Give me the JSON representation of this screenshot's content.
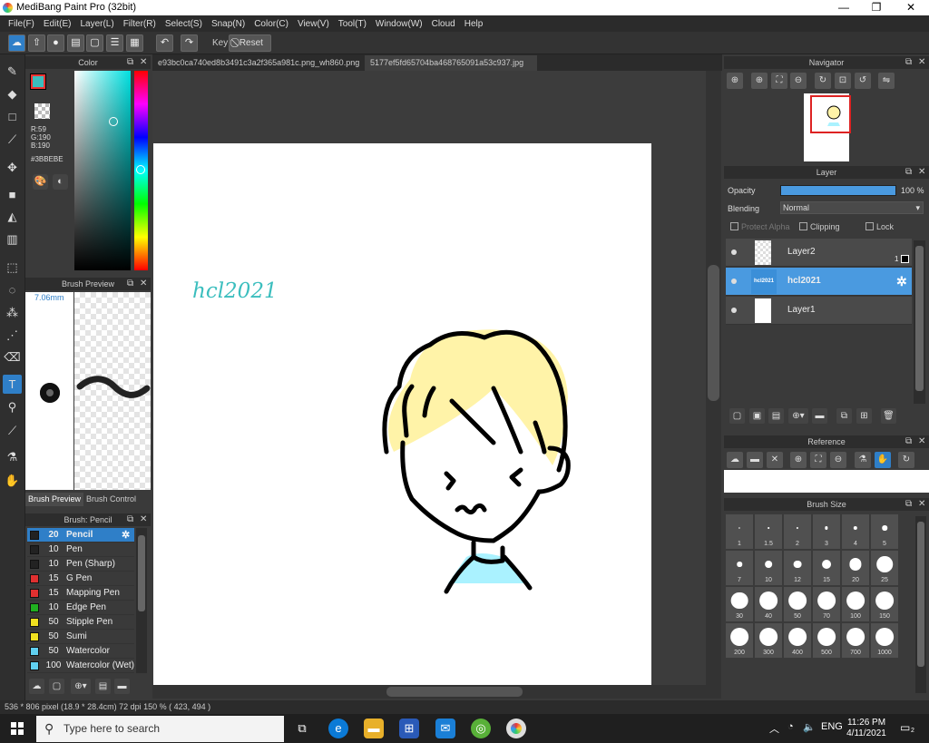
{
  "window": {
    "title": "MediBang Paint Pro (32bit)",
    "min": "—",
    "max": "❐",
    "close": "✕"
  },
  "menu": [
    "File(F)",
    "Edit(E)",
    "Layer(L)",
    "Filter(R)",
    "Select(S)",
    "Snap(N)",
    "Color(C)",
    "View(V)",
    "Tool(T)",
    "Window(W)",
    "Cloud",
    "Help"
  ],
  "toolbar": {
    "key_label": "Key",
    "reset_label": "Reset"
  },
  "color_panel": {
    "title": "Color",
    "hex": "#3BBEBE",
    "r": "R:59",
    "g": "G:190",
    "b": "B:190",
    "main_color": "#3bbebe",
    "sub_color": "#ffffff"
  },
  "brush_preview": {
    "title": "Brush Preview",
    "size": "7.06mm",
    "tab_preview": "Brush Preview",
    "tab_control": "Brush Control"
  },
  "brush_list": {
    "title": "Brush: Pencil",
    "items": [
      {
        "size": "20",
        "name": "Pencil",
        "color": "#222222",
        "selected": true
      },
      {
        "size": "10",
        "name": "Pen",
        "color": "#222222"
      },
      {
        "size": "10",
        "name": "Pen (Sharp)",
        "color": "#222222"
      },
      {
        "size": "15",
        "name": "G Pen",
        "color": "#e03030"
      },
      {
        "size": "15",
        "name": "Mapping Pen",
        "color": "#e03030"
      },
      {
        "size": "10",
        "name": "Edge Pen",
        "color": "#20b020"
      },
      {
        "size": "50",
        "name": "Stipple Pen",
        "color": "#f0e020"
      },
      {
        "size": "50",
        "name": "Sumi",
        "color": "#f0e020"
      },
      {
        "size": "50",
        "name": "Watercolor",
        "color": "#60d0f0"
      },
      {
        "size": "100",
        "name": "Watercolor (Wet)",
        "color": "#60d0f0"
      }
    ]
  },
  "doc_tabs": [
    {
      "label": "e93bc0ca740ed8b3491c3a2f365a981c.png_wh860.png",
      "active": false
    },
    {
      "label": "5177ef5fd65704ba468765091a53c937.jpg",
      "active": true
    }
  ],
  "canvas": {
    "signature": "hcl2021"
  },
  "status": {
    "text": "536 * 806 pixel   (18.9 * 28.4cm)   72 dpi   150 %   ( 423, 494 )"
  },
  "navigator": {
    "title": "Navigator"
  },
  "layer_panel": {
    "title": "Layer",
    "opacity_label": "Opacity",
    "opacity_value": "100 %",
    "blending_label": "Blending",
    "blending_value": "Normal",
    "protect_alpha": "Protect Alpha",
    "clipping": "Clipping",
    "lock": "Lock",
    "layers": [
      {
        "name": "Layer2",
        "badge": "1",
        "selected": false
      },
      {
        "name": "hcl2021",
        "selected": true
      },
      {
        "name": "Layer1",
        "selected": false
      }
    ]
  },
  "reference": {
    "title": "Reference"
  },
  "brush_size": {
    "title": "Brush Size",
    "sizes": [
      "1",
      "1.5",
      "2",
      "3",
      "4",
      "5",
      "7",
      "10",
      "12",
      "15",
      "20",
      "25",
      "30",
      "40",
      "50",
      "70",
      "100",
      "150",
      "200",
      "300",
      "400",
      "500",
      "700",
      "1000"
    ]
  },
  "taskbar": {
    "search_placeholder": "Type here to search",
    "lang": "ENG",
    "time": "11:26 PM",
    "date": "4/11/2021",
    "notif": "2"
  }
}
